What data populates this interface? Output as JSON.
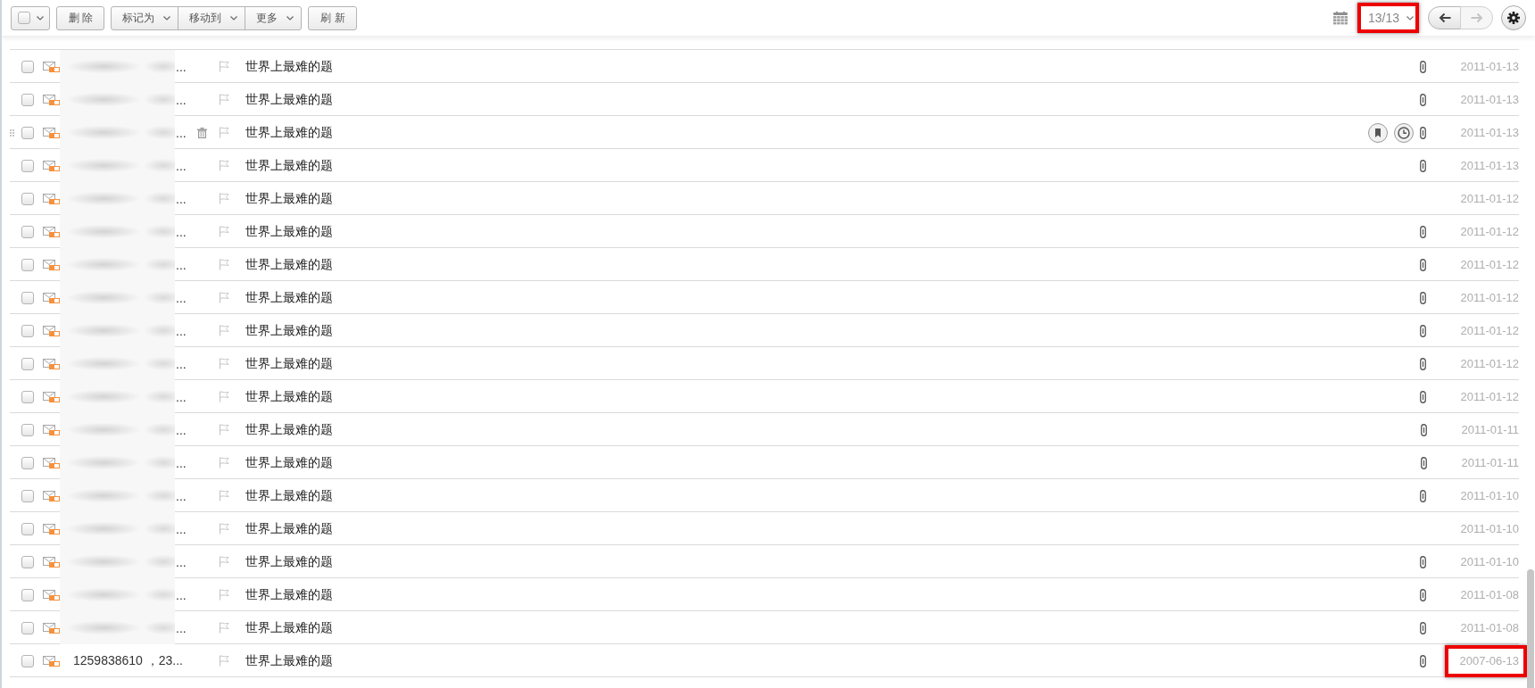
{
  "toolbar": {
    "select_all": {
      "checked": false
    },
    "action_groups": [
      [
        {
          "kind": "button",
          "label": "删 除"
        }
      ],
      [
        {
          "kind": "menu",
          "label": "标记为"
        },
        {
          "kind": "menu",
          "label": "移动到"
        },
        {
          "kind": "menu",
          "label": "更多"
        }
      ],
      [
        {
          "kind": "button",
          "label": "刷 新"
        }
      ]
    ],
    "page_counter": {
      "label": "13/13",
      "highlighted": true
    },
    "prev": {
      "disabled": false
    },
    "next": {
      "disabled": true
    }
  },
  "messages": [
    {
      "checked": false,
      "sender": "...",
      "sender_blurred": true,
      "flagged": false,
      "subject": "世界上最难的题",
      "attachment": true,
      "date": "2011-01-13",
      "hovered": false,
      "date_highlighted": false
    },
    {
      "checked": false,
      "sender": "...",
      "sender_blurred": true,
      "flagged": false,
      "subject": "世界上最难的题",
      "attachment": true,
      "date": "2011-01-13",
      "hovered": false,
      "date_highlighted": false
    },
    {
      "checked": false,
      "sender": "...",
      "sender_blurred": true,
      "flagged": false,
      "subject": "世界上最难的题",
      "attachment": true,
      "date": "2011-01-13",
      "hovered": true,
      "date_highlighted": false
    },
    {
      "checked": false,
      "sender": "...",
      "sender_blurred": true,
      "flagged": false,
      "subject": "世界上最难的题",
      "attachment": true,
      "date": "2011-01-13",
      "hovered": false,
      "date_highlighted": false
    },
    {
      "checked": false,
      "sender": "...",
      "sender_blurred": true,
      "flagged": false,
      "subject": "世界上最难的题",
      "attachment": false,
      "date": "2011-01-12",
      "hovered": false,
      "date_highlighted": false
    },
    {
      "checked": false,
      "sender": "...",
      "sender_blurred": true,
      "flagged": false,
      "subject": "世界上最难的题",
      "attachment": true,
      "date": "2011-01-12",
      "hovered": false,
      "date_highlighted": false
    },
    {
      "checked": false,
      "sender": "...",
      "sender_blurred": true,
      "flagged": false,
      "subject": "世界上最难的题",
      "attachment": true,
      "date": "2011-01-12",
      "hovered": false,
      "date_highlighted": false
    },
    {
      "checked": false,
      "sender": "...",
      "sender_blurred": true,
      "flagged": false,
      "subject": "世界上最难的题",
      "attachment": true,
      "date": "2011-01-12",
      "hovered": false,
      "date_highlighted": false
    },
    {
      "checked": false,
      "sender": "...",
      "sender_blurred": true,
      "flagged": false,
      "subject": "世界上最难的题",
      "attachment": true,
      "date": "2011-01-12",
      "hovered": false,
      "date_highlighted": false
    },
    {
      "checked": false,
      "sender": "...",
      "sender_blurred": true,
      "flagged": false,
      "subject": "世界上最难的题",
      "attachment": true,
      "date": "2011-01-12",
      "hovered": false,
      "date_highlighted": false
    },
    {
      "checked": false,
      "sender": "...",
      "sender_blurred": true,
      "flagged": false,
      "subject": "世界上最难的题",
      "attachment": true,
      "date": "2011-01-12",
      "hovered": false,
      "date_highlighted": false
    },
    {
      "checked": false,
      "sender": "...",
      "sender_blurred": true,
      "flagged": false,
      "subject": "世界上最难的题",
      "attachment": true,
      "date": "2011-01-11",
      "hovered": false,
      "date_highlighted": false
    },
    {
      "checked": false,
      "sender": "...",
      "sender_blurred": true,
      "flagged": false,
      "subject": "世界上最难的题",
      "attachment": true,
      "date": "2011-01-11",
      "hovered": false,
      "date_highlighted": false
    },
    {
      "checked": false,
      "sender": "...",
      "sender_blurred": true,
      "flagged": false,
      "subject": "世界上最难的题",
      "attachment": true,
      "date": "2011-01-10",
      "hovered": false,
      "date_highlighted": false
    },
    {
      "checked": false,
      "sender": "...",
      "sender_blurred": true,
      "flagged": false,
      "subject": "世界上最难的题",
      "attachment": false,
      "date": "2011-01-10",
      "hovered": false,
      "date_highlighted": false
    },
    {
      "checked": false,
      "sender": "...",
      "sender_blurred": true,
      "flagged": false,
      "subject": "世界上最难的题",
      "attachment": true,
      "date": "2011-01-10",
      "hovered": false,
      "date_highlighted": false
    },
    {
      "checked": false,
      "sender": "...",
      "sender_blurred": true,
      "flagged": false,
      "subject": "世界上最难的题",
      "attachment": true,
      "date": "2011-01-08",
      "hovered": false,
      "date_highlighted": false
    },
    {
      "checked": false,
      "sender": "...",
      "sender_blurred": true,
      "flagged": false,
      "subject": "世界上最难的题",
      "attachment": true,
      "date": "2011-01-08",
      "hovered": false,
      "date_highlighted": false
    },
    {
      "checked": false,
      "sender": "1259838610 ，23...",
      "sender_blurred": false,
      "flagged": false,
      "subject": "世界上最难的题",
      "attachment": true,
      "date": "2007-06-13",
      "hovered": false,
      "date_highlighted": true
    }
  ]
}
